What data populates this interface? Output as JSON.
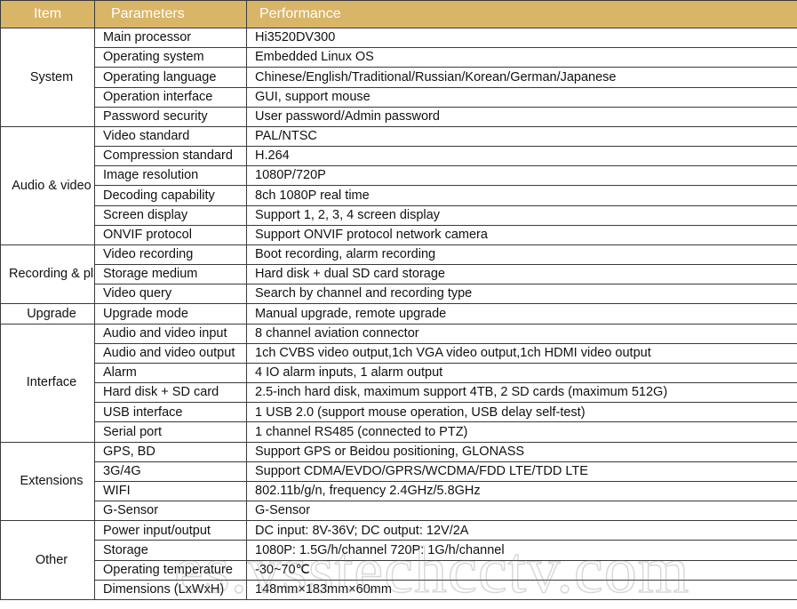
{
  "table": {
    "headers": {
      "item": "Item",
      "parameters": "Parameters",
      "performance": "Performance"
    },
    "header_bg_color": "#d9b568",
    "header_text_color": "#ffffff",
    "border_color": "#3a3a3a",
    "sections": [
      {
        "item": "System",
        "rows": [
          {
            "parameter": "Main processor",
            "performance": "Hi3520DV300"
          },
          {
            "parameter": "Operating system",
            "performance": "Embedded Linux OS"
          },
          {
            "parameter": "Operating language",
            "performance": "Chinese/English/Traditional/Russian/Korean/German/Japanese"
          },
          {
            "parameter": "Operation interface",
            "performance": "GUI, support mouse"
          },
          {
            "parameter": "Password security",
            "performance": "User password/Admin password"
          }
        ]
      },
      {
        "item": "Audio\n&\nvideo",
        "rows": [
          {
            "parameter": "Video standard",
            "performance": "PAL/NTSC"
          },
          {
            "parameter": "Compression standard",
            "performance": "H.264"
          },
          {
            "parameter": "Image resolution",
            "performance": "1080P/720P"
          },
          {
            "parameter": "Decoding capability",
            "performance": "8ch 1080P real time"
          },
          {
            "parameter": "Screen display",
            "performance": "Support 1, 2, 3, 4 screen display"
          },
          {
            "parameter": "ONVIF protocol",
            "performance": "Support ONVIF protocol network camera"
          }
        ]
      },
      {
        "item": "Recording\n&\nplayback",
        "rows": [
          {
            "parameter": "Video recording",
            "performance": "Boot recording, alarm recording"
          },
          {
            "parameter": "Storage medium",
            "performance": "Hard disk + dual SD card storage"
          },
          {
            "parameter": "Video query",
            "performance": "Search by channel and recording type"
          }
        ]
      },
      {
        "item": "Upgrade",
        "rows": [
          {
            "parameter": "Upgrade mode",
            "performance": "Manual upgrade, remote upgrade"
          }
        ]
      },
      {
        "item": "Interface",
        "rows": [
          {
            "parameter": "Audio and video input",
            "performance": "8 channel aviation connector"
          },
          {
            "parameter": "Audio and video output",
            "performance": "1ch CVBS video output,1ch VGA video output,1ch HDMI video output"
          },
          {
            "parameter": "Alarm",
            "performance": "4 IO alarm inputs, 1 alarm output"
          },
          {
            "parameter": "Hard disk + SD card",
            "performance": "2.5-inch hard disk, maximum support 4TB, 2 SD cards (maximum 512G)"
          },
          {
            "parameter": "USB interface",
            "performance": "1 USB 2.0 (support mouse operation, USB delay self-test)"
          },
          {
            "parameter": "Serial port",
            "performance": "1 channel RS485 (connected to PTZ)"
          }
        ]
      },
      {
        "item": "Extensions",
        "rows": [
          {
            "parameter": "GPS, BD",
            "performance": "Support GPS or Beidou positioning, GLONASS"
          },
          {
            "parameter": "3G/4G",
            "performance": "Support CDMA/EVDO/GPRS/WCDMA/FDD LTE/TDD LTE"
          },
          {
            "parameter": "WIFI",
            "performance": "802.11b/g/n, frequency 2.4GHz/5.8GHz"
          },
          {
            "parameter": "G-Sensor",
            "performance": "G-Sensor"
          }
        ]
      },
      {
        "item": "Other",
        "rows": [
          {
            "parameter": "Power input/output",
            "performance": "DC input: 8V-36V; DC output: 12V/2A"
          },
          {
            "parameter": "Storage",
            "performance": "1080P: 1.5G/h/channel  720P: 1G/h/channel"
          },
          {
            "parameter": "Operating temperature",
            "performance": "-30~70℃"
          },
          {
            "parameter": "Dimensions (LxWxH)",
            "performance": "148mm×183mm×60mm"
          }
        ]
      }
    ]
  },
  "watermark": {
    "text": "es.vsstechcctv.com"
  }
}
